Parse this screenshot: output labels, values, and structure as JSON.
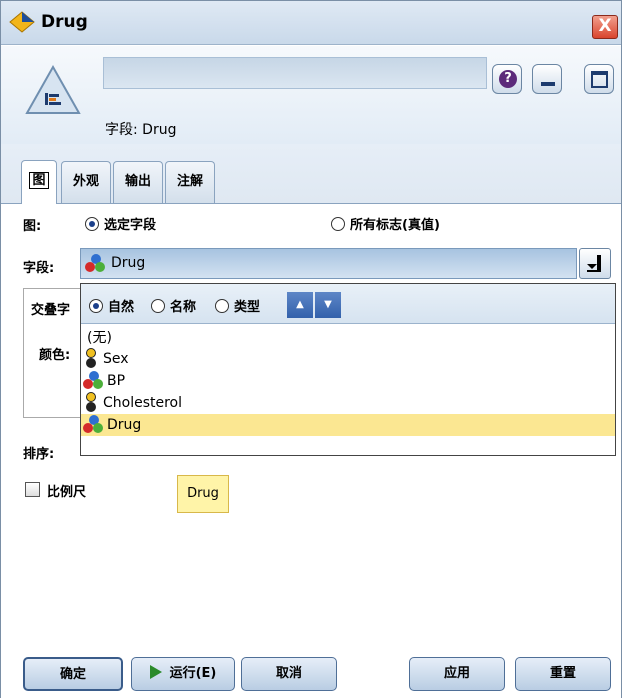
{
  "window": {
    "title": "Drug",
    "close_label": "X"
  },
  "header": {
    "field_caption": "字段: Drug",
    "help_label": "?"
  },
  "tabs": [
    {
      "label": "图",
      "active": true
    },
    {
      "label": "外观",
      "active": false
    },
    {
      "label": "输出",
      "active": false
    },
    {
      "label": "注解",
      "active": false
    }
  ],
  "plot": {
    "label": "图:",
    "option_selected": "选定字段",
    "option_all": "所有标志(真值)",
    "selected": "选定字段"
  },
  "field": {
    "label": "字段:",
    "value": "Drug"
  },
  "dropdown": {
    "sort_options": [
      "自然",
      "名称",
      "类型"
    ],
    "sort_selected": "自然",
    "items": [
      "(无)",
      "Sex",
      "BP",
      "Cholesterol",
      "Drug"
    ],
    "selected_item": "Drug"
  },
  "overlap_group": {
    "label": "交叠字",
    "color_label": "颜色:"
  },
  "sort": {
    "label": "排序:"
  },
  "scale": {
    "label": "比例尺",
    "checked": false
  },
  "tooltip": {
    "text": "Drug"
  },
  "buttons": {
    "ok": "确定",
    "run": "运行(E)",
    "cancel": "取消",
    "apply": "应用",
    "reset": "重置"
  },
  "colors": {
    "selection": "#fbe792",
    "title_bar": "#c9d9ea",
    "sort_button": "#3361ab"
  }
}
